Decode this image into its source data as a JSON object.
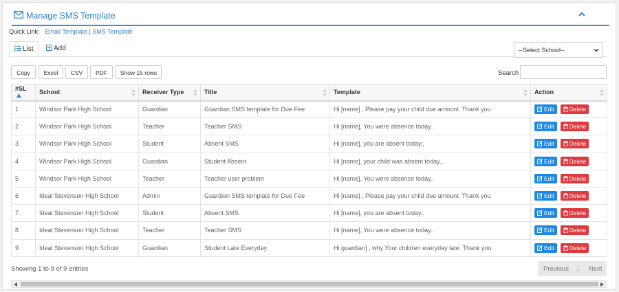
{
  "header": {
    "title": "Manage SMS Template"
  },
  "quick_link": {
    "label": "Quick Link:",
    "links": "Email Template | SMS Template"
  },
  "tabs": {
    "list": "List",
    "add": "Add"
  },
  "school_select": {
    "selected": "--Select School--"
  },
  "toolbar": {
    "copy": "Copy",
    "excel": "Excel",
    "csv": "CSV",
    "pdf": "PDF",
    "show_rows": "Show 15 rows"
  },
  "search": {
    "label": "Search"
  },
  "table": {
    "headers": {
      "sl": "#SL",
      "school": "School",
      "receiver": "Receiver Type",
      "title": "Title",
      "template": "Template",
      "action": "Action"
    },
    "edit_label": "Edit",
    "delete_label": "Delete",
    "rows": [
      {
        "sl": "1",
        "school": "Windsor Park High School",
        "receiver": "Guardian",
        "title": "Guardian SMS template for Due Fee",
        "template": "Hi [name] , Please pay your child due amount. Thank you"
      },
      {
        "sl": "2",
        "school": "Windsor Park High School",
        "receiver": "Teacher",
        "title": "Teacher SMS",
        "template": "Hi [name], You were absence today.."
      },
      {
        "sl": "3",
        "school": "Windsor Park High School",
        "receiver": "Student",
        "title": "Absent SMS",
        "template": "Hi [name], you are absent today.."
      },
      {
        "sl": "4",
        "school": "Windsor Park High School",
        "receiver": "Guardian",
        "title": "Student Absent",
        "template": "Hi [name], your child was absent today..."
      },
      {
        "sl": "5",
        "school": "Windsor Park High School",
        "receiver": "Teacher",
        "title": "Teacher user problem",
        "template": "Hi [name], You were absence today.."
      },
      {
        "sl": "6",
        "school": "Ideal Stevenson High School",
        "receiver": "Admin",
        "title": "Guardian SMS template for Due Fee",
        "template": "Hi [name] , Please pay your child due amount. Thank you"
      },
      {
        "sl": "7",
        "school": "Ideal Stevenson High School",
        "receiver": "Student",
        "title": "Absent SMS",
        "template": "Hi [name], you are absent today.."
      },
      {
        "sl": "8",
        "school": "Ideal Stevenson High School",
        "receiver": "Teacher",
        "title": "Teacher SMS",
        "template": "Hi [name], You were absence today.."
      },
      {
        "sl": "9",
        "school": "Ideal Stevenson High School",
        "receiver": "Guardian",
        "title": "Student Late Everyday",
        "template": "Hi guardian] , why Your children everyday late. Thank you"
      }
    ]
  },
  "footer": {
    "info": "Showing 1 to 9 of 9 entries",
    "prev": "Previous",
    "page": "1",
    "next": "Next"
  }
}
